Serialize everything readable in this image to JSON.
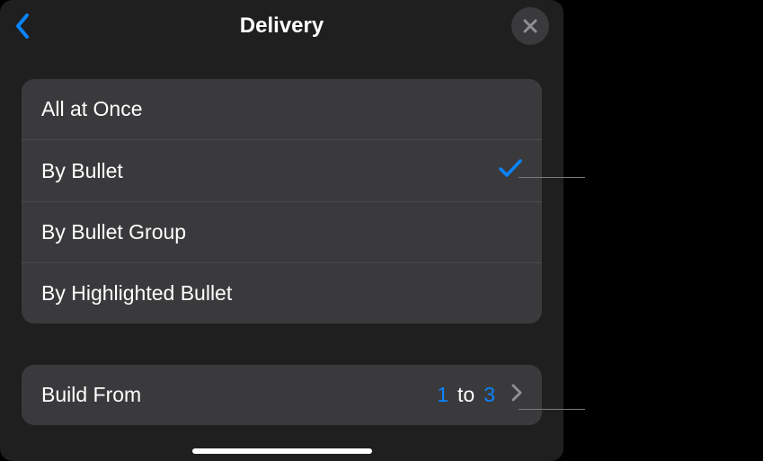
{
  "header": {
    "title": "Delivery"
  },
  "options": {
    "items": [
      {
        "label": "All at Once",
        "selected": false
      },
      {
        "label": "By Bullet",
        "selected": true
      },
      {
        "label": "By Bullet Group",
        "selected": false
      },
      {
        "label": "By Highlighted Bullet",
        "selected": false
      }
    ]
  },
  "build": {
    "label": "Build From",
    "from": "1",
    "to_word": "to",
    "to": "3"
  }
}
